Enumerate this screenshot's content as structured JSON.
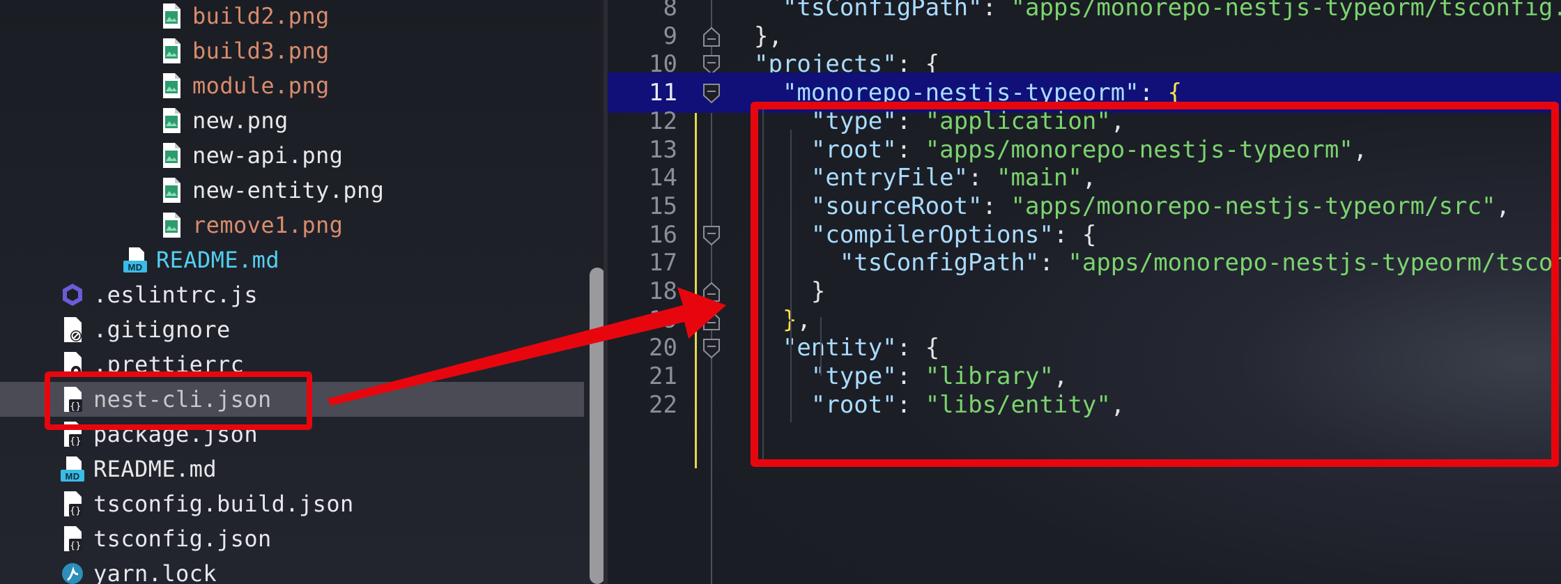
{
  "file_tree": {
    "items": [
      {
        "label": "build2.png",
        "icon": "image-file-icon",
        "status": "modified"
      },
      {
        "label": "build3.png",
        "icon": "image-file-icon",
        "status": "modified"
      },
      {
        "label": "module.png",
        "icon": "image-file-icon",
        "status": "modified"
      },
      {
        "label": "new.png",
        "icon": "image-file-icon",
        "status": "normal"
      },
      {
        "label": "new-api.png",
        "icon": "image-file-icon",
        "status": "normal"
      },
      {
        "label": "new-entity.png",
        "icon": "image-file-icon",
        "status": "normal"
      },
      {
        "label": "remove1.png",
        "icon": "image-file-icon",
        "status": "modified"
      },
      {
        "label": "README.md",
        "icon": "markdown-file-icon",
        "status": "markdown"
      },
      {
        "label": ".eslintrc.js",
        "icon": "eslint-file-icon",
        "status": "normal"
      },
      {
        "label": ".gitignore",
        "icon": "gitignore-file-icon",
        "status": "normal"
      },
      {
        "label": ".prettierrc",
        "icon": "config-file-icon",
        "status": "normal"
      },
      {
        "label": "nest-cli.json",
        "icon": "json-file-icon",
        "status": "selected"
      },
      {
        "label": "package.json",
        "icon": "json-file-icon",
        "status": "normal"
      },
      {
        "label": "README.md",
        "icon": "markdown-file-icon",
        "status": "normal"
      },
      {
        "label": "tsconfig.build.json",
        "icon": "json-file-icon",
        "status": "normal"
      },
      {
        "label": "tsconfig.json",
        "icon": "json-file-icon",
        "status": "normal"
      },
      {
        "label": "yarn.lock",
        "icon": "yarn-file-icon",
        "status": "normal"
      }
    ]
  },
  "editor": {
    "current_line": "11",
    "lines": [
      {
        "num": "8",
        "text": "  \"tsConfigPath\": \"apps/monorepo-nestjs-typeorm/tsconfig.a"
      },
      {
        "num": "9",
        "text": "},"
      },
      {
        "num": "10",
        "text": "\"projects\": {"
      },
      {
        "num": "11",
        "text": "  \"monorepo-nestjs-typeorm\": {"
      },
      {
        "num": "12",
        "text": "    \"type\": \"application\","
      },
      {
        "num": "13",
        "text": "    \"root\": \"apps/monorepo-nestjs-typeorm\","
      },
      {
        "num": "14",
        "text": "    \"entryFile\": \"main\","
      },
      {
        "num": "15",
        "text": "    \"sourceRoot\": \"apps/monorepo-nestjs-typeorm/src\","
      },
      {
        "num": "16",
        "text": "    \"compilerOptions\": {"
      },
      {
        "num": "17",
        "text": "      \"tsConfigPath\": \"apps/monorepo-nestjs-typeorm/tscon"
      },
      {
        "num": "18",
        "text": "    }"
      },
      {
        "num": "19",
        "text": "  },"
      },
      {
        "num": "20",
        "text": "  \"entity\": {"
      },
      {
        "num": "21",
        "text": "    \"type\": \"library\","
      },
      {
        "num": "22",
        "text": "    \"root\": \"libs/entity\","
      }
    ]
  },
  "colors": {
    "annotation_red": "#e8060e",
    "current_line_bg": "#101078",
    "string_green": "#7bd46e",
    "modified_file_orange": "#d98c6d",
    "markdown_file_cyan": "#52d0f0"
  }
}
